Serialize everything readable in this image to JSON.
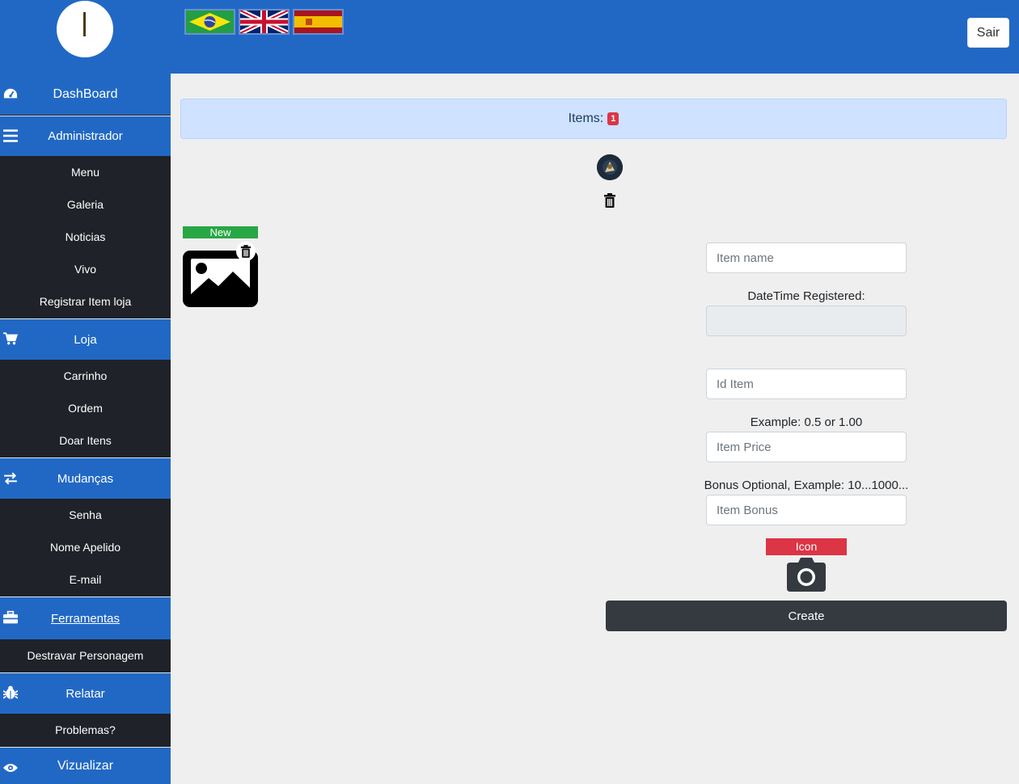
{
  "header": {
    "flags": [
      {
        "name": "Brasil"
      },
      {
        "name": "United Kingdom"
      },
      {
        "name": "España"
      }
    ],
    "logout_label": "Sair"
  },
  "sidebar": {
    "dashboard": "DashBoard",
    "administrador": {
      "label": "Administrador",
      "items": [
        "Menu",
        "Galeria",
        "Noticias",
        "Vivo",
        "Registrar Item loja"
      ]
    },
    "loja": {
      "label": "Loja",
      "items": [
        "Carrinho",
        "Ordem",
        "Doar Itens"
      ]
    },
    "mudancas": {
      "label": "Mudanças",
      "items": [
        "Senha",
        "Nome Apelido",
        "E-mail"
      ]
    },
    "ferramentas": {
      "label": "Ferramentas",
      "items": [
        "Destravar Personagem"
      ]
    },
    "relatar": {
      "label": "Relatar",
      "items": [
        "Problemas?"
      ]
    },
    "vizualizar": "Vizualizar"
  },
  "main": {
    "items_label": "Items:",
    "items_count": "1",
    "new_badge": "New",
    "form": {
      "item_name_placeholder": "Item name",
      "datetime_label": "DateTime Registered:",
      "datetime_value": "",
      "id_item_placeholder": "Id Item",
      "price_hint": "Example: 0.5 or 1.00",
      "price_placeholder": "Item Price",
      "bonus_hint": "Bonus Optional, Example: 10...1000...",
      "bonus_placeholder": "Item Bonus",
      "icon_label": "Icon",
      "create_label": "Create"
    }
  },
  "colors": {
    "primary_blue": "#2168c5",
    "sidebar_dark": "#1f2228",
    "danger": "#dc3545",
    "success": "#28a745",
    "dark_button": "#343a40",
    "alert_bg": "#cfe2ff"
  },
  "icons": {
    "dashboard": "tachometer-icon",
    "administrador": "bars-icon",
    "loja": "shopping-cart-icon",
    "mudancas": "exchange-icon",
    "ferramentas": "toolbox-icon",
    "relatar": "bug-icon",
    "vizualizar": "eye-icon"
  }
}
